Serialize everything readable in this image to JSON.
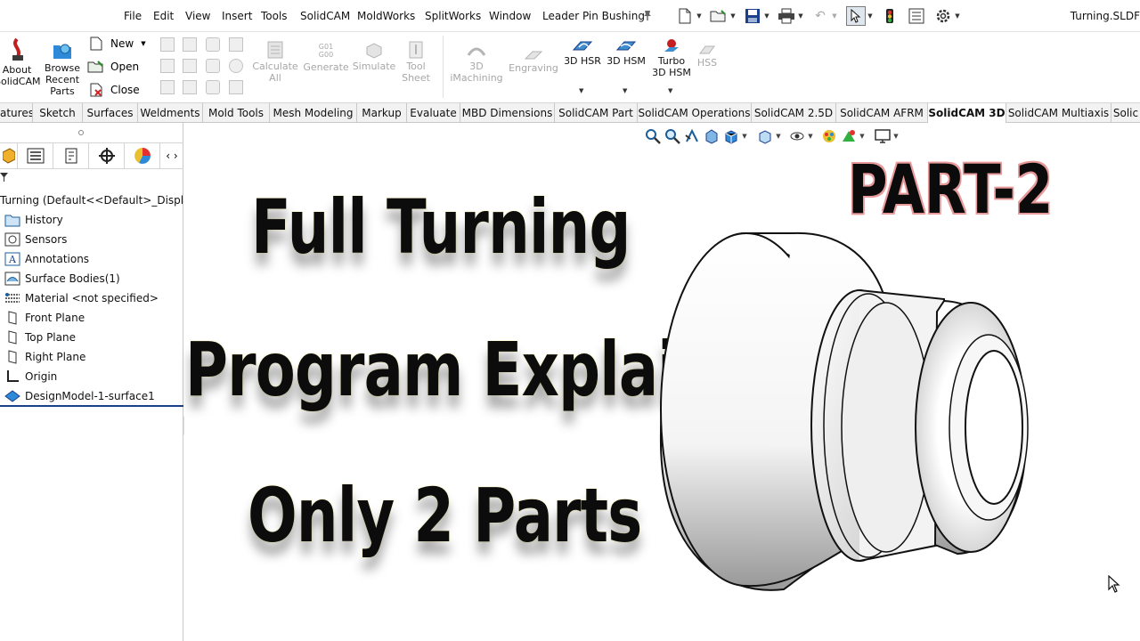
{
  "menu": {
    "items": [
      "File",
      "Edit",
      "View",
      "Insert",
      "Tools",
      "SolidCAM",
      "MoldWorks",
      "SplitWorks",
      "Window",
      "Leader Pin Bushing"
    ],
    "doc_title": "Turning.SLDF"
  },
  "ribbon": {
    "about": "About SolidCAM",
    "browse": "Browse Recent Parts",
    "new": "New",
    "open": "Open",
    "close": "Close",
    "calculate": "Calculate All",
    "gcode": "G01 G00",
    "generate": "Generate",
    "simulate": "Simulate",
    "toolsheet": "Tool Sheet",
    "imachining": "3D iMachining",
    "engraving": "Engraving",
    "hsr": "3D HSR",
    "hsm": "3D HSM",
    "turbo": "Turbo 3D HSM",
    "hss": "HSS"
  },
  "tabs": [
    "atures",
    "Sketch",
    "Surfaces",
    "Weldments",
    "Mold Tools",
    "Mesh Modeling",
    "Markup",
    "Evaluate",
    "MBD Dimensions",
    "SolidCAM Part",
    "SolidCAM Operations",
    "SolidCAM 2.5D",
    "SolidCAM AFRM",
    "SolidCAM 3D",
    "SolidCAM Multiaxis",
    "Solic"
  ],
  "active_tab": "SolidCAM 3D",
  "tree": {
    "root": "Turning  (Default<<Default>_Display S",
    "items": [
      "History",
      "Sensors",
      "Annotations",
      "Surface Bodies(1)",
      "Material <not specified>",
      "Front Plane",
      "Top Plane",
      "Right Plane",
      "Origin",
      "DesignModel-1-surface1"
    ]
  },
  "overlay": {
    "line1": "Full Turning",
    "line2": "Program Explain",
    "line3": "Only 2 Parts",
    "badge": "PART-2"
  },
  "colors": {
    "accent": "#1b3f8b",
    "badge_outline": "#e89a9a",
    "text_glow": "#fffde0"
  }
}
